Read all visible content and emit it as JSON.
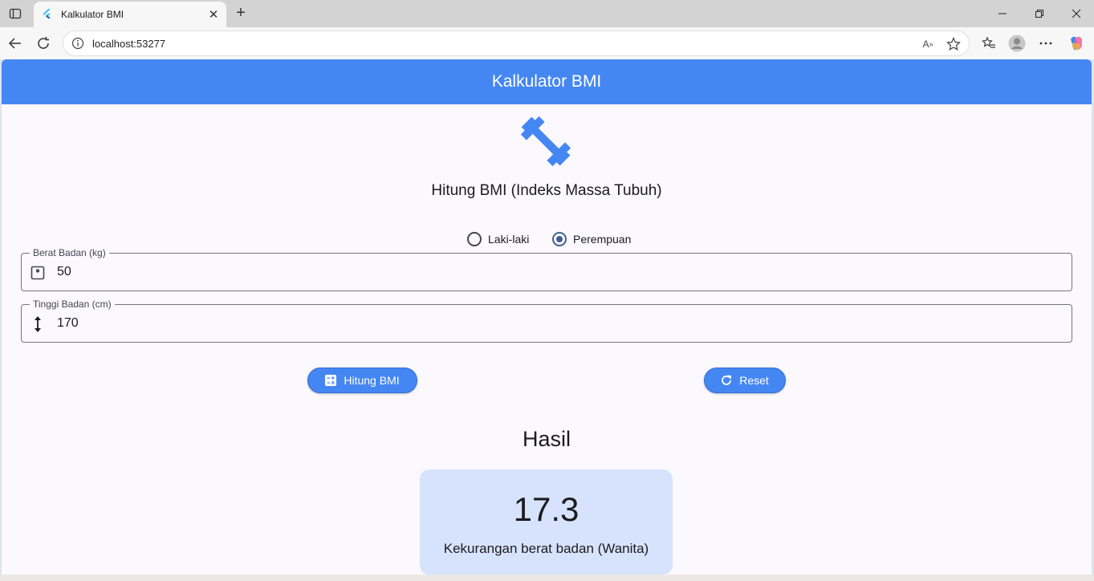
{
  "browser": {
    "tab_title": "Kalkulator BMI",
    "url": "localhost:53277"
  },
  "app": {
    "title": "Kalkulator BMI",
    "subtitle": "Hitung BMI (Indeks Massa Tubuh)",
    "accent_color": "#4487f3",
    "gender": {
      "options": [
        "Laki-laki",
        "Perempuan"
      ],
      "selected": "Perempuan"
    },
    "weight_field": {
      "label": "Berat Badan (kg)",
      "value": "50",
      "icon": "scale-icon"
    },
    "height_field": {
      "label": "Tinggi Badan (cm)",
      "value": "170",
      "icon": "height-icon"
    },
    "calculate_button": {
      "label": "Hitung BMI",
      "icon": "calculate-icon"
    },
    "reset_button": {
      "label": "Reset",
      "icon": "refresh-icon"
    },
    "result": {
      "heading": "Hasil",
      "value": "17.3",
      "category": "Kekurangan berat badan (Wanita)",
      "card_color": "#d7e3fc"
    }
  }
}
